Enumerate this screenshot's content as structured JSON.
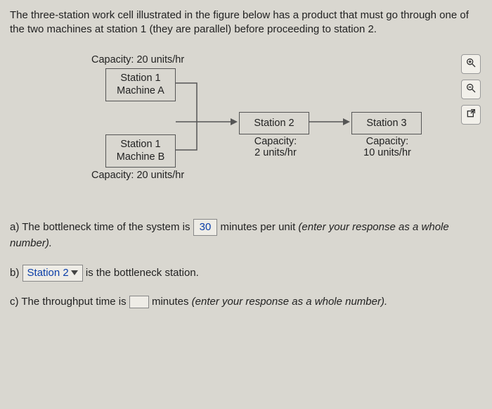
{
  "intro": "The three-station work cell illustrated in the figure below has a product that must go through one of the two machines at station 1 (they are parallel) before proceeding to station 2.",
  "diagram": {
    "cap_top": "Capacity: 20 units/hr",
    "s1a_l1": "Station 1",
    "s1a_l2": "Machine A",
    "s1b_l1": "Station 1",
    "s1b_l2": "Machine B",
    "cap_bottom": "Capacity: 20 units/hr",
    "s2_label": "Station 2",
    "s2_cap_l1": "Capacity:",
    "s2_cap_l2": "2 units/hr",
    "s3_label": "Station 3",
    "s3_cap_l1": "Capacity:",
    "s3_cap_l2": "10 units/hr"
  },
  "qa": {
    "a_pre": "a) The bottleneck time of the system is ",
    "a_ans": "30",
    "a_mid": " minutes per unit ",
    "a_post": "(enter your response as a whole number).",
    "b_pre": "b) ",
    "b_ans": "Station 2",
    "b_post": " is the bottleneck station.",
    "c_pre": "c) The throughput time is ",
    "c_mid": " minutes ",
    "c_post": "(enter your response as a whole number)."
  },
  "tools": {
    "zoom_in": "zoom-in",
    "zoom_out": "zoom-out",
    "open_new": "open-new"
  }
}
